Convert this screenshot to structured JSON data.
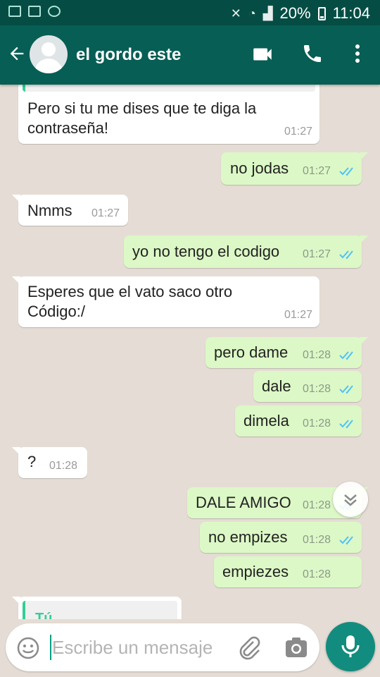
{
  "status_bar": {
    "battery": "20%",
    "time": "11:04"
  },
  "header": {
    "contact_name": "el gordo este"
  },
  "messages": [
    {
      "dir": "in",
      "text": [
        "Pero si tu me dises que te diga la",
        "contraseña!"
      ],
      "time": "01:27"
    },
    {
      "dir": "out",
      "text": [
        "no jodas"
      ],
      "time": "01:27"
    },
    {
      "dir": "in",
      "text": [
        "Nmms"
      ],
      "time": "01:27"
    },
    {
      "dir": "out",
      "text": [
        "yo no tengo el codigo"
      ],
      "time": "01:27"
    },
    {
      "dir": "in",
      "text": [
        "Esperes que el vato saco otro",
        "Código:/"
      ],
      "time": "01:27"
    },
    {
      "dir": "out",
      "text": [
        "pero dame"
      ],
      "time": "01:28"
    },
    {
      "dir": "out",
      "text": [
        "dale"
      ],
      "time": "01:28"
    },
    {
      "dir": "out",
      "text": [
        "dimela"
      ],
      "time": "01:28"
    },
    {
      "dir": "in",
      "text": [
        "?"
      ],
      "time": "01:28"
    },
    {
      "dir": "out",
      "text": [
        "DALE AMIGO"
      ],
      "time": "01:28"
    },
    {
      "dir": "out",
      "text": [
        "no empizes"
      ],
      "time": "01:28"
    },
    {
      "dir": "out",
      "text": [
        "empiezes"
      ],
      "time": "01:28"
    }
  ],
  "reply_preview": {
    "name": "Tú"
  },
  "input": {
    "placeholder": "Escribe un mensaje"
  },
  "colors": {
    "header": "#075e54",
    "status_bar": "#054d44",
    "outgoing_bubble": "#dcf8c6",
    "incoming_bubble": "#ffffff",
    "read_tick": "#4fc3f7",
    "accent": "#128c7e"
  },
  "icons": {
    "back": "arrow-left-icon",
    "video": "video-camera-icon",
    "call": "phone-icon",
    "menu": "more-vertical-icon",
    "emoji": "emoji-icon",
    "attach": "paperclip-icon",
    "camera": "camera-icon",
    "mic": "microphone-icon",
    "scroll_down": "double-chevron-down-icon"
  }
}
